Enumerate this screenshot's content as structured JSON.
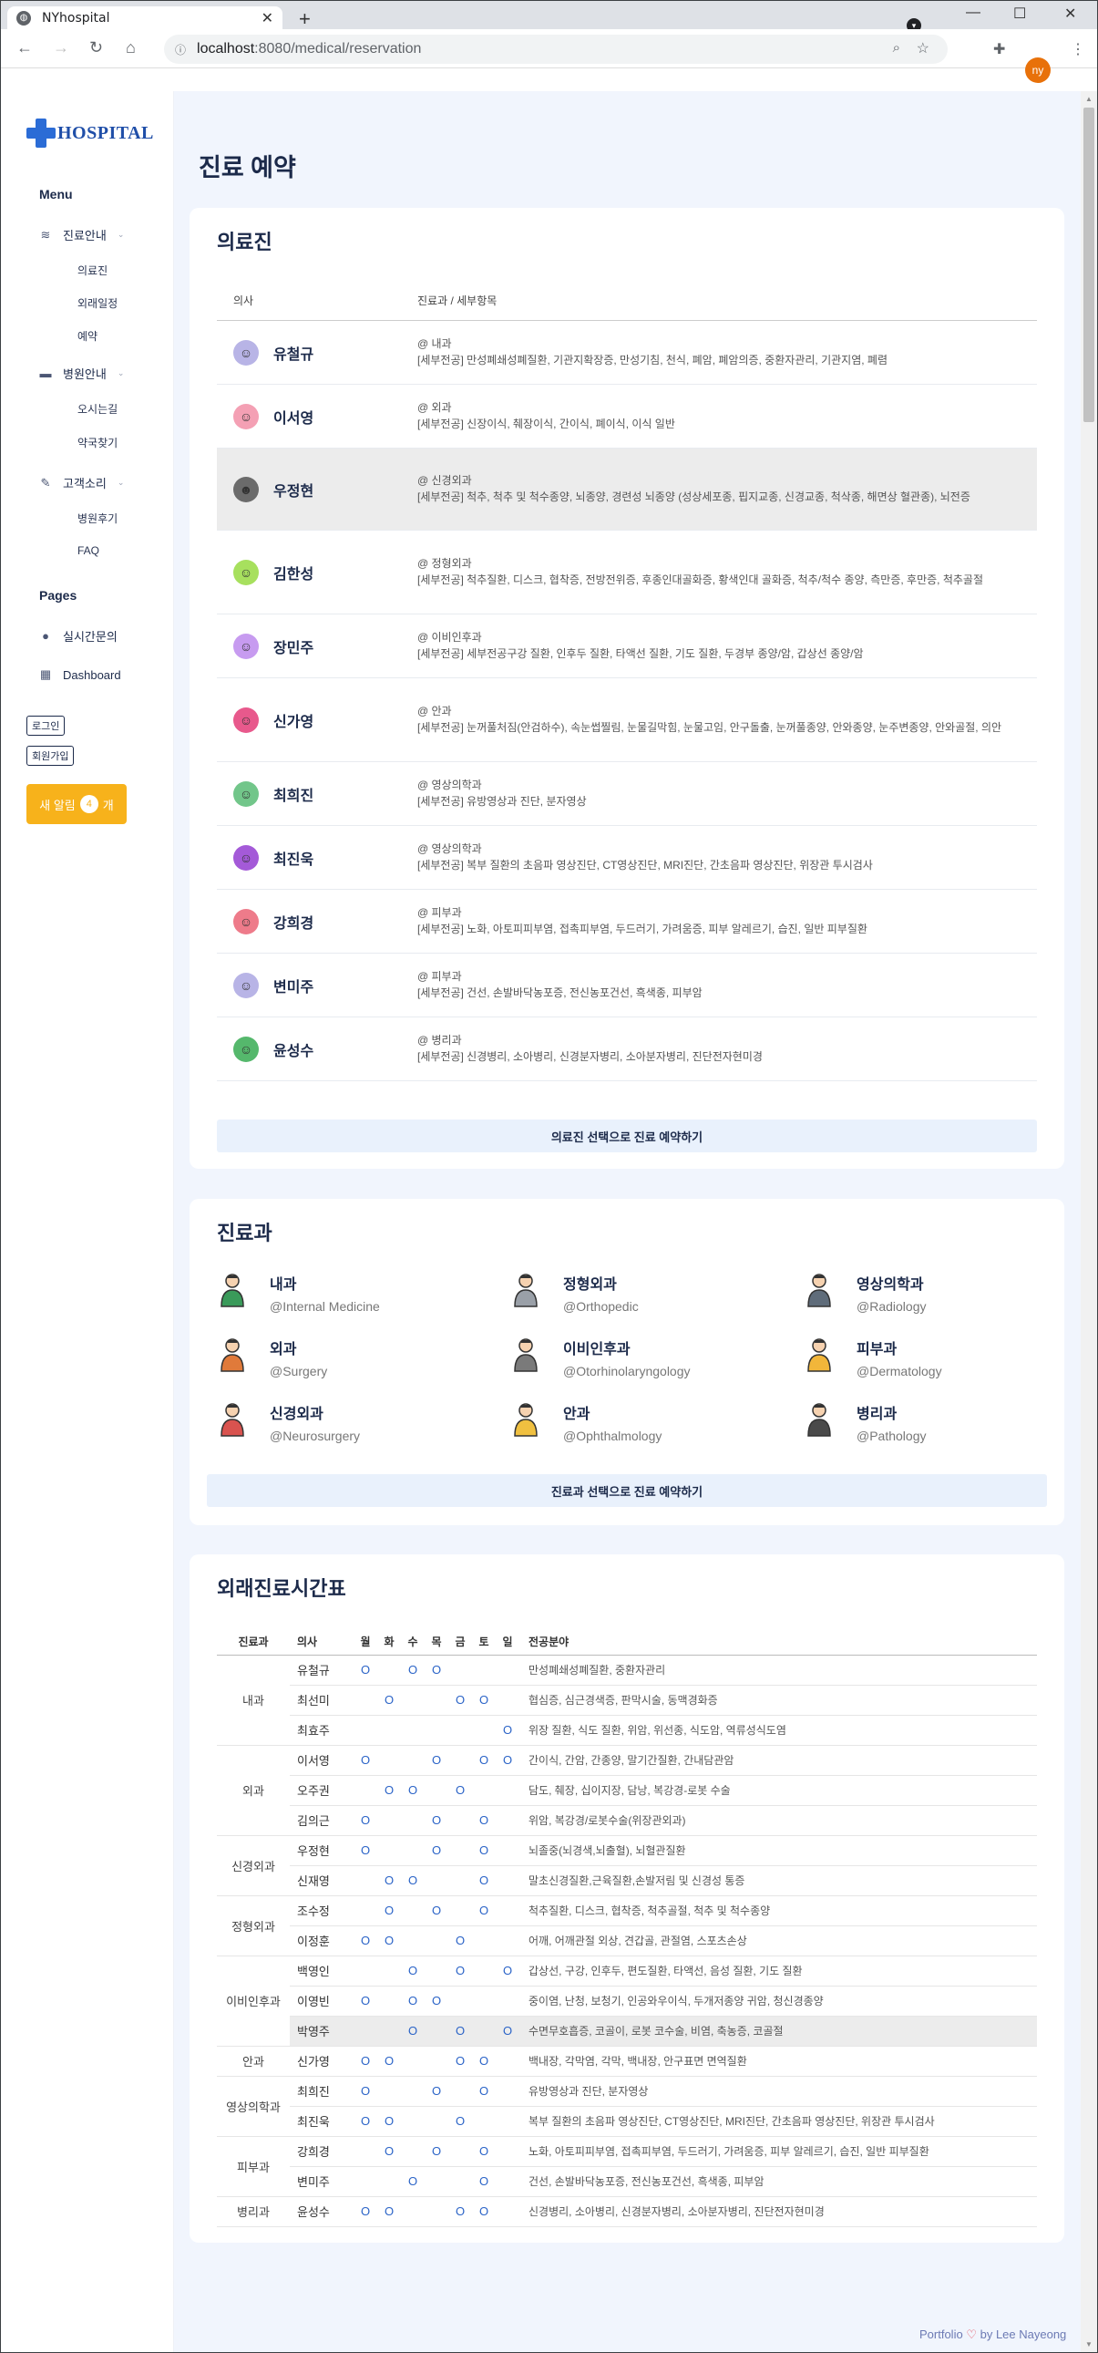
{
  "browser": {
    "tab_title": "NYhospital",
    "url_host": "localhost",
    "url_path": ":8080/medical/reservation",
    "profile_initials": "ny"
  },
  "sidebar": {
    "logo_text": "HOSPITAL",
    "menu_heading": "Menu",
    "groups": [
      {
        "label": "진료안내",
        "icon": "layers-icon",
        "items": [
          "의료진",
          "외래일정",
          "예약"
        ]
      },
      {
        "label": "병원안내",
        "icon": "building-icon",
        "items": [
          "오시는길",
          "약국찾기"
        ]
      },
      {
        "label": "고객소리",
        "icon": "pencil-icon",
        "items": [
          "병원후기",
          "FAQ"
        ]
      }
    ],
    "pages_heading": "Pages",
    "pages": [
      {
        "label": "실시간문의",
        "icon": "chat-icon"
      },
      {
        "label": "Dashboard",
        "icon": "grid-icon"
      }
    ],
    "login_label": "로그인",
    "signup_label": "회원가입",
    "alert_prefix": "새 알림",
    "alert_count": "4",
    "alert_suffix": "개"
  },
  "page_title": "진료 예약",
  "doctors_card": {
    "title": "의료진",
    "col_doctor": "의사",
    "col_dept": "진료과 / 세부항목",
    "rows": [
      {
        "name": "유철규",
        "dept": "@ 내과",
        "detail": "[세부전공] 만성폐쇄성폐질환, 기관지확장증, 만성기침, 천식, 폐암, 폐암의증, 중환자관리, 기관지염, 폐렴"
      },
      {
        "name": "이서영",
        "dept": "@ 외과",
        "detail": "[세부전공] 신장이식, 췌장이식, 간이식, 폐이식, 이식 일반"
      },
      {
        "name": "우정현",
        "dept": "@ 신경외과",
        "detail": "[세부전공] 척추, 척추 및 척수종양, 뇌종양, 경련성 뇌종양 (성상세포종, 핍지교종, 신경교종, 척삭종, 해면상 혈관종), 뇌전증"
      },
      {
        "name": "김한성",
        "dept": "@ 정형외과",
        "detail": "[세부전공] 척추질환, 디스크, 협착증, 전방전위증, 후종인대골화증, 황색인대 골화증, 척추/척수 종양, 측만증, 후만증, 척추골절"
      },
      {
        "name": "장민주",
        "dept": "@ 이비인후과",
        "detail": "[세부전공] 세부전공구강 질환, 인후두 질환, 타액선 질환, 기도 질환, 두경부 종양/암, 갑상선 종양/암"
      },
      {
        "name": "신가영",
        "dept": "@ 안과",
        "detail": "[세부전공] 눈꺼풀처짐(안검하수), 속눈썹찔림, 눈물길막힘, 눈물고임, 안구돌출, 눈꺼풀종양, 안와종양, 눈주변종양, 안와골절, 의안"
      },
      {
        "name": "최희진",
        "dept": "@ 영상의학과",
        "detail": "[세부전공] 유방영상과 진단, 분자영상"
      },
      {
        "name": "최진욱",
        "dept": "@ 영상의학과",
        "detail": "[세부전공] 복부 질환의 초음파 영상진단, CT영상진단, MRI진단, 간초음파 영상진단, 위장관 투시검사"
      },
      {
        "name": "강희경",
        "dept": "@ 피부과",
        "detail": "[세부전공] 노화, 아토피피부염, 접촉피부염, 두드러기, 가려움증, 피부 알레르기, 습진, 일반 피부질환"
      },
      {
        "name": "변미주",
        "dept": "@ 피부과",
        "detail": "[세부전공] 건선, 손발바닥농포증, 전신농포건선, 흑색종, 피부암"
      },
      {
        "name": "윤성수",
        "dept": "@ 병리과",
        "detail": "[세부전공] 신경병리, 소아병리, 신경분자병리, 소아분자병리, 진단전자현미경"
      }
    ],
    "button_label": "의료진 선택으로 진료 예약하기"
  },
  "dept_card": {
    "title": "진료과",
    "items": [
      {
        "name": "내과",
        "eng": "@Internal Medicine",
        "icon": "doctor-internal-icon"
      },
      {
        "name": "정형외과",
        "eng": "@Orthopedic",
        "icon": "doctor-orthopedic-icon"
      },
      {
        "name": "영상의학과",
        "eng": "@Radiology",
        "icon": "doctor-radiology-icon"
      },
      {
        "name": "외과",
        "eng": "@Surgery",
        "icon": "doctor-surgery-icon"
      },
      {
        "name": "이비인후과",
        "eng": "@Otorhinolaryngology",
        "icon": "doctor-ent-icon"
      },
      {
        "name": "피부과",
        "eng": "@Dermatology",
        "icon": "doctor-dermatology-icon"
      },
      {
        "name": "신경외과",
        "eng": "@Neurosurgery",
        "icon": "doctor-neurosurgery-icon"
      },
      {
        "name": "안과",
        "eng": "@Ophthalmology",
        "icon": "doctor-ophthalmology-icon"
      },
      {
        "name": "병리과",
        "eng": "@Pathology",
        "icon": "doctor-pathology-icon"
      }
    ],
    "button_label": "진료과 선택으로 진료 예약하기"
  },
  "schedule_card": {
    "title": "외래진료시간표",
    "headers": [
      "진료과",
      "의사",
      "월",
      "화",
      "수",
      "목",
      "금",
      "토",
      "일",
      "전공분야"
    ],
    "mark": "O",
    "groups": [
      {
        "dept": "내과",
        "rows": [
          {
            "doctor": "유철규",
            "days": [
              1,
              0,
              1,
              1,
              0,
              0,
              0
            ],
            "specialty": "만성폐쇄성폐질환, 중환자관리"
          },
          {
            "doctor": "최선미",
            "days": [
              0,
              1,
              0,
              0,
              1,
              1,
              0
            ],
            "specialty": "협심증, 심근경색증, 판막시술, 동맥경화증"
          },
          {
            "doctor": "최효주",
            "days": [
              0,
              0,
              0,
              0,
              0,
              0,
              1
            ],
            "specialty": "위장 질환, 식도 질환, 위암, 위선종, 식도암, 역류성식도염"
          }
        ]
      },
      {
        "dept": "외과",
        "rows": [
          {
            "doctor": "이서영",
            "days": [
              1,
              0,
              0,
              1,
              0,
              1,
              1
            ],
            "specialty": "간이식, 간암, 간종양, 말기간질환, 간내담관암"
          },
          {
            "doctor": "오주권",
            "days": [
              0,
              1,
              1,
              0,
              1,
              0,
              0
            ],
            "specialty": "담도, 췌장, 십이지장, 담낭, 복강경-로봇 수술"
          },
          {
            "doctor": "김의근",
            "days": [
              1,
              0,
              0,
              1,
              0,
              1,
              0
            ],
            "specialty": "위암, 복강경/로봇수술(위장관외과)"
          }
        ]
      },
      {
        "dept": "신경외과",
        "rows": [
          {
            "doctor": "우정현",
            "days": [
              1,
              0,
              0,
              1,
              0,
              1,
              0
            ],
            "specialty": "뇌졸중(뇌경색,뇌출혈), 뇌혈관질환"
          },
          {
            "doctor": "신재영",
            "days": [
              0,
              1,
              1,
              0,
              0,
              1,
              0
            ],
            "specialty": "말초신경질환,근육질환,손발저림 및 신경성 통증"
          }
        ]
      },
      {
        "dept": "정형외과",
        "rows": [
          {
            "doctor": "조수정",
            "days": [
              0,
              1,
              0,
              1,
              0,
              1,
              0
            ],
            "specialty": "척추질환, 디스크, 협착증, 척추골절, 척추 및 척수종양"
          },
          {
            "doctor": "이정훈",
            "days": [
              1,
              1,
              0,
              0,
              1,
              0,
              0
            ],
            "specialty": "어깨, 어깨관절 외상, 견갑골, 관절염, 스포츠손상"
          }
        ]
      },
      {
        "dept": "이비인후과",
        "rows": [
          {
            "doctor": "백영인",
            "days": [
              0,
              0,
              1,
              0,
              1,
              0,
              1
            ],
            "specialty": "갑상선, 구강, 인후두, 편도질환, 타액선, 음성 질환, 기도 질환"
          },
          {
            "doctor": "이영빈",
            "days": [
              1,
              0,
              1,
              1,
              0,
              0,
              0
            ],
            "specialty": "중이염, 난청, 보청기, 인공와우이식, 두개저종양 귀암, 청신경종양"
          },
          {
            "doctor": "박영주",
            "days": [
              0,
              0,
              1,
              0,
              1,
              0,
              1
            ],
            "specialty": "수면무호흡증, 코골이, 로봇 코수술, 비염, 축농증, 코골절",
            "highlight": true
          }
        ]
      },
      {
        "dept": "안과",
        "rows": [
          {
            "doctor": "신가영",
            "days": [
              1,
              1,
              0,
              0,
              1,
              1,
              0
            ],
            "specialty": "백내장, 각막염, 각막, 백내장, 안구표면 면역질환"
          }
        ]
      },
      {
        "dept": "영상의학과",
        "rows": [
          {
            "doctor": "최희진",
            "days": [
              1,
              0,
              0,
              1,
              0,
              1,
              0
            ],
            "specialty": "유방영상과 진단, 분자영상"
          },
          {
            "doctor": "최진욱",
            "days": [
              1,
              1,
              0,
              0,
              1,
              0,
              0
            ],
            "specialty": "복부 질환의 초음파 영상진단, CT영상진단, MRI진단, 간초음파 영상진단, 위장관 투시검사"
          }
        ]
      },
      {
        "dept": "피부과",
        "rows": [
          {
            "doctor": "강희경",
            "days": [
              0,
              1,
              0,
              1,
              0,
              1,
              0
            ],
            "specialty": "노화, 아토피피부염, 접촉피부염, 두드러기, 가려움증, 피부 알레르기, 습진, 일반 피부질환"
          },
          {
            "doctor": "변미주",
            "days": [
              0,
              0,
              1,
              0,
              0,
              1,
              0
            ],
            "specialty": "건선, 손발바닥농포증, 전신농포건선, 흑색종, 피부암"
          }
        ]
      },
      {
        "dept": "병리과",
        "rows": [
          {
            "doctor": "윤성수",
            "days": [
              1,
              1,
              0,
              0,
              1,
              1,
              0
            ],
            "specialty": "신경병리, 소아병리, 신경분자병리, 소아분자병리, 진단전자현미경"
          }
        ]
      }
    ]
  },
  "footer": {
    "text_before": "Portfolio",
    "text_after": "by Lee Nayeong"
  },
  "colors": {
    "accent": "#2b6cd6",
    "navy": "#1c2a4a",
    "page_bg": "#f1f5fd",
    "alert": "#f7b21b"
  }
}
